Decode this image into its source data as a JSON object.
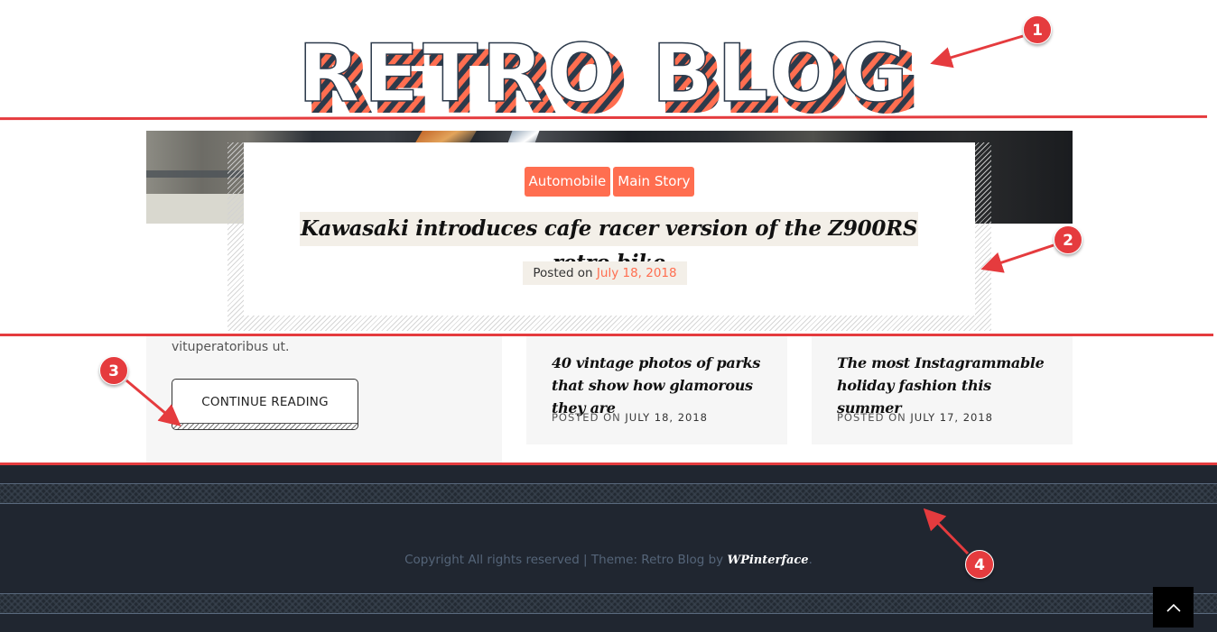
{
  "site": {
    "logo_text": "RETRO BLOG"
  },
  "featured": {
    "categories": [
      "Automobile",
      "Main Story"
    ],
    "title": "Kawasaki introduces cafe racer version of the Z900RS retro bike",
    "posted_prefix": "Posted on",
    "posted_date": "July 18, 2018"
  },
  "post_left": {
    "excerpt_tail": "vituperatoribus ut.",
    "continue_label": "CONTINUE READING"
  },
  "posts": [
    {
      "title": "40 vintage photos of parks that show how glamorous they are",
      "posted_prefix": "POSTED ON",
      "date": "JULY 18, 2018"
    },
    {
      "title": "The most Instagrammable holiday fashion this summer",
      "posted_prefix": "POSTED ON",
      "date": "JULY 17, 2018"
    }
  ],
  "footer": {
    "copyright": "Copyright All rights reserved | Theme: Retro Blog by ",
    "brand": "WPinterface",
    "brand_suffix": ".",
    "scroll_top_icon": "chevron-up-icon"
  },
  "annotations": {
    "markers": [
      "1",
      "2",
      "3",
      "4"
    ]
  },
  "colors": {
    "accent": "#ff6e50",
    "annotation_red": "#e53b3e",
    "footer_bg": "#202630",
    "card_bg": "#f6f6f6",
    "title_bg": "#f3efe8",
    "logo_dark": "#2c3a4b"
  }
}
